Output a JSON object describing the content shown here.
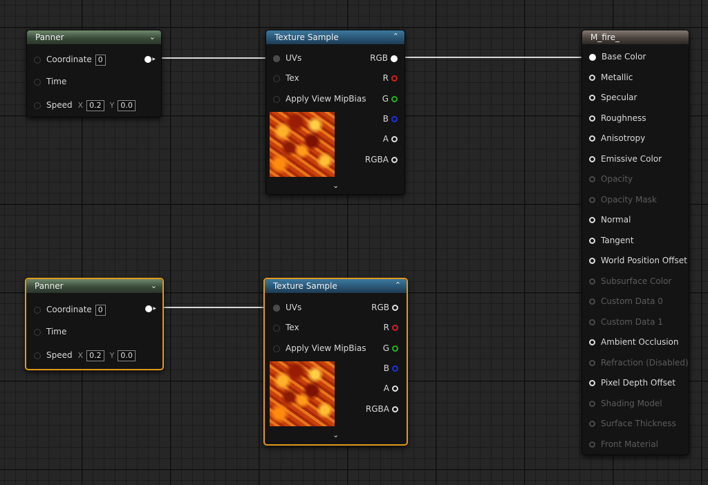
{
  "panner_top": {
    "title": "Panner",
    "coordinate_label": "Coordinate",
    "coordinate_value": "0",
    "time_label": "Time",
    "speed_label": "Speed",
    "x_label": "X",
    "x_value": "0.2",
    "y_label": "Y",
    "y_value": "0.0"
  },
  "panner_bottom": {
    "title": "Panner",
    "coordinate_label": "Coordinate",
    "coordinate_value": "0",
    "time_label": "Time",
    "speed_label": "Speed",
    "x_label": "X",
    "x_value": "0.2",
    "y_label": "Y",
    "y_value": "0.0"
  },
  "texture_top": {
    "title": "Texture Sample",
    "inputs": [
      "UVs",
      "Tex",
      "Apply View MipBias"
    ],
    "outputs": [
      "RGB",
      "R",
      "G",
      "B",
      "A",
      "RGBA"
    ]
  },
  "texture_bottom": {
    "title": "Texture Sample",
    "inputs": [
      "UVs",
      "Tex",
      "Apply View MipBias"
    ],
    "outputs": [
      "RGB",
      "R",
      "G",
      "B",
      "A",
      "RGBA"
    ]
  },
  "material": {
    "title": "M_fire_",
    "pins": [
      {
        "label": "Base Color",
        "enabled": true
      },
      {
        "label": "Metallic",
        "enabled": true
      },
      {
        "label": "Specular",
        "enabled": true
      },
      {
        "label": "Roughness",
        "enabled": true
      },
      {
        "label": "Anisotropy",
        "enabled": true
      },
      {
        "label": "Emissive Color",
        "enabled": true
      },
      {
        "label": "Opacity",
        "enabled": false
      },
      {
        "label": "Opacity Mask",
        "enabled": false
      },
      {
        "label": "Normal",
        "enabled": true
      },
      {
        "label": "Tangent",
        "enabled": true
      },
      {
        "label": "World Position Offset",
        "enabled": true
      },
      {
        "label": "Subsurface Color",
        "enabled": false
      },
      {
        "label": "Custom Data 0",
        "enabled": false
      },
      {
        "label": "Custom Data 1",
        "enabled": false
      },
      {
        "label": "Ambient Occlusion",
        "enabled": true
      },
      {
        "label": "Refraction (Disabled)",
        "enabled": false
      },
      {
        "label": "Pixel Depth Offset",
        "enabled": true
      },
      {
        "label": "Shading Model",
        "enabled": false
      },
      {
        "label": "Surface Thickness",
        "enabled": false
      },
      {
        "label": "Front Material",
        "enabled": false
      }
    ]
  },
  "colors": {
    "selection": "#e09a1c",
    "panner_header": "#3b4c3b",
    "texture_header": "#2a5676",
    "material_header": "#4a423d"
  },
  "icons": {
    "collapse": "chevron-down-icon",
    "expand": "chevron-up-icon",
    "texture_preview": "fire-texture-thumbnail"
  }
}
